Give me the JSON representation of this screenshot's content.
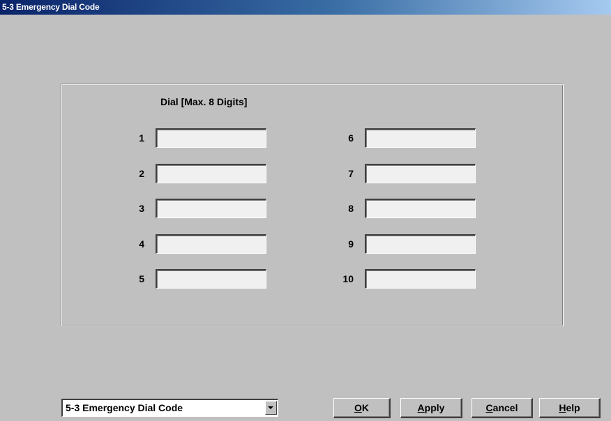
{
  "window": {
    "title": "5-3 Emergency Dial Code"
  },
  "form": {
    "column_header": "Dial [Max. 8 Digits]",
    "entries": [
      {
        "label": "1",
        "value": ""
      },
      {
        "label": "2",
        "value": ""
      },
      {
        "label": "3",
        "value": ""
      },
      {
        "label": "4",
        "value": ""
      },
      {
        "label": "5",
        "value": ""
      },
      {
        "label": "6",
        "value": ""
      },
      {
        "label": "7",
        "value": ""
      },
      {
        "label": "8",
        "value": ""
      },
      {
        "label": "9",
        "value": ""
      },
      {
        "label": "10",
        "value": ""
      }
    ]
  },
  "footer": {
    "page_select": {
      "selected": "5-3 Emergency Dial Code"
    },
    "buttons": {
      "ok": {
        "mnemonic": "O",
        "rest": "K"
      },
      "apply": {
        "mnemonic": "A",
        "rest": "pply"
      },
      "cancel": {
        "mnemonic": "C",
        "rest": "ancel"
      },
      "help": {
        "mnemonic": "H",
        "rest": "elp"
      }
    }
  },
  "colors": {
    "titlebar_start": "#0a246a",
    "titlebar_end": "#a6caf0",
    "dialog_face": "#c0c0c0"
  }
}
